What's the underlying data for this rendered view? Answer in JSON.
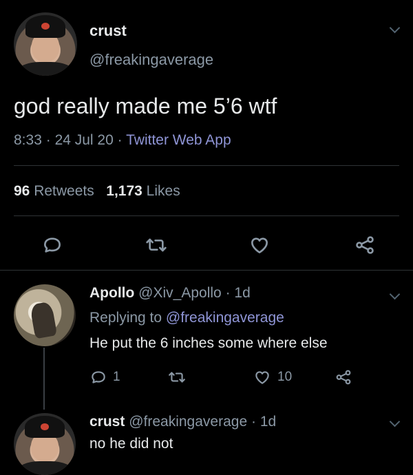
{
  "main_tweet": {
    "author_name": "crust",
    "author_handle": "@freakingaverage",
    "text": "god really made me 5’6 wtf",
    "time": "8:33",
    "sep1": "·",
    "date": "24 Jul 20",
    "sep2": "·",
    "source": "Twitter Web App",
    "retweets_count": "96",
    "retweets_label": "Retweets",
    "likes_count": "1,173",
    "likes_label": "Likes"
  },
  "reply1": {
    "author_name": "Apollo",
    "author_handle": "@Xiv_Apollo",
    "sep": "·",
    "age": "1d",
    "replying_label": "Replying to",
    "replying_to": "@freakingaverage",
    "text": "He put the 6 inches some where else",
    "reply_count": "1",
    "like_count": "10"
  },
  "reply2": {
    "author_name": "crust",
    "author_handle": "@freakingaverage",
    "sep": "·",
    "age": "1d",
    "text": "no he did not"
  },
  "icons": {
    "reply": "reply-icon",
    "retweet": "retweet-icon",
    "like": "heart-icon",
    "share": "share-icon",
    "more": "chevron-down-icon"
  },
  "colors": {
    "background": "#000000",
    "text": "#e7e9ea",
    "muted": "#8b98a5",
    "link": "#8f95d6"
  }
}
